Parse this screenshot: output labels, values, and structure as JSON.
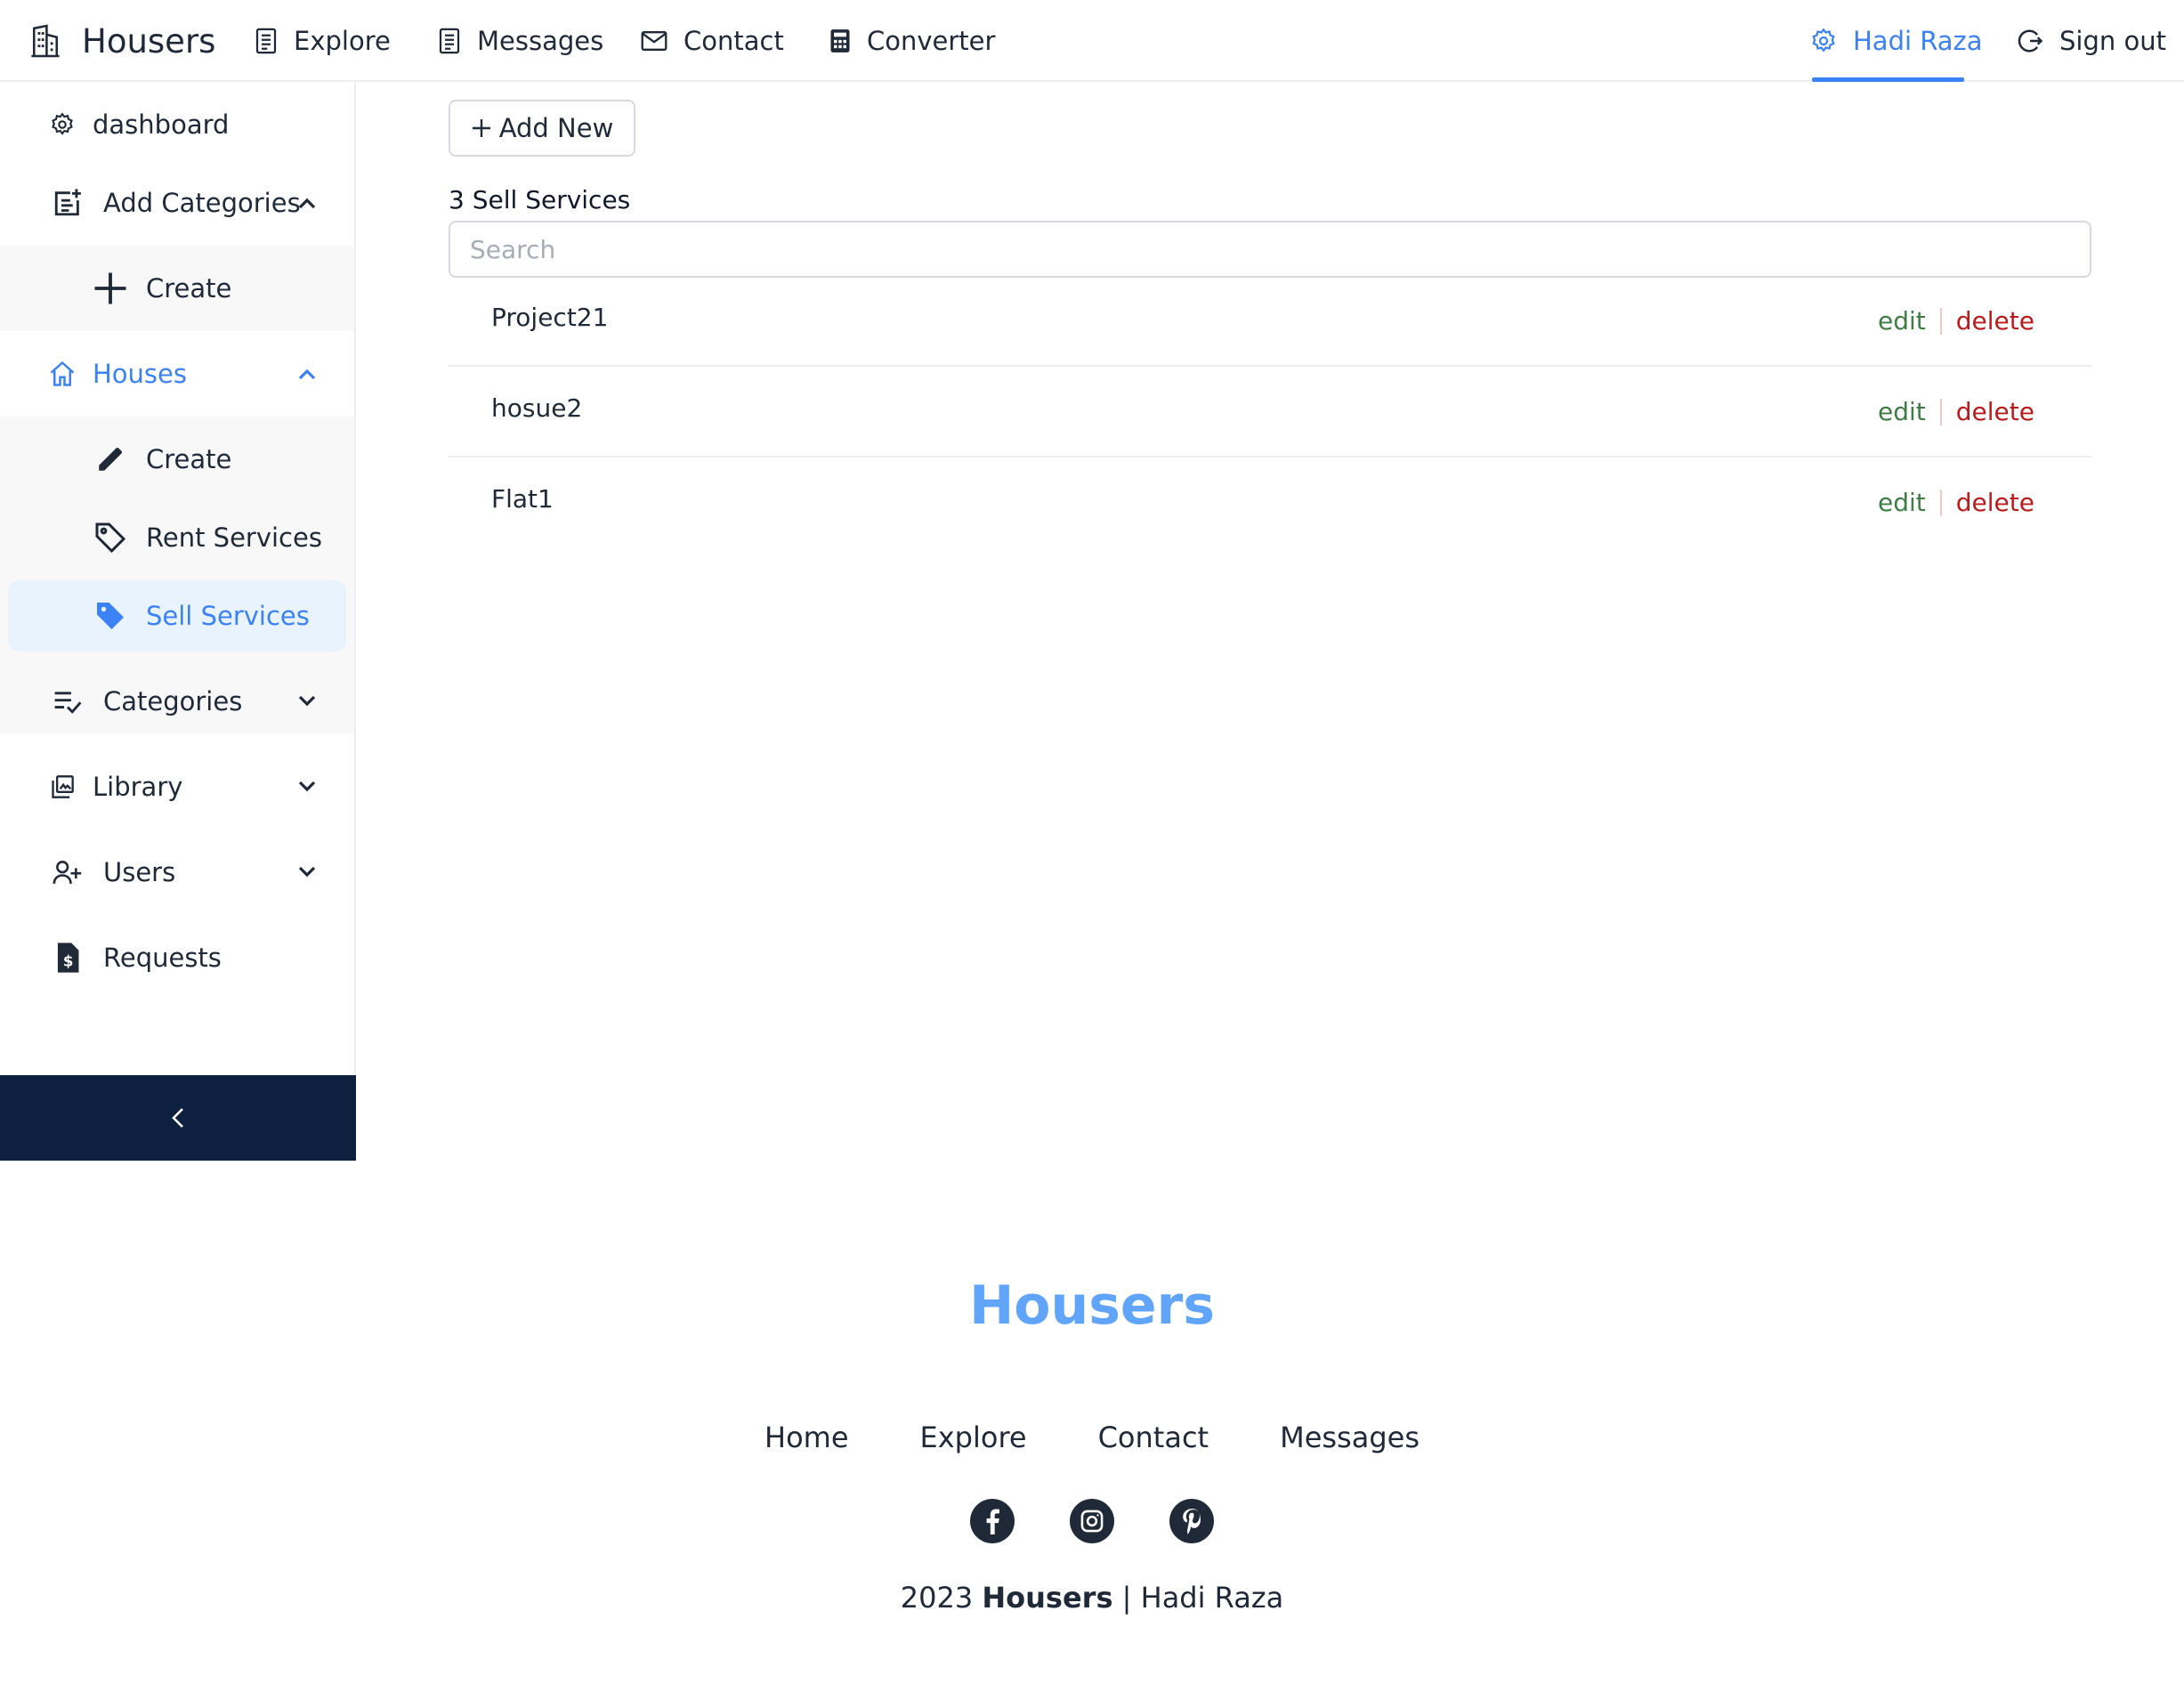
{
  "header": {
    "brand": "Housers",
    "nav": [
      {
        "label": "Explore",
        "icon": "list-doc-icon"
      },
      {
        "label": "Messages",
        "icon": "list-doc-icon"
      },
      {
        "label": "Contact",
        "icon": "mail-icon"
      },
      {
        "label": "Converter",
        "icon": "calculator-icon"
      }
    ],
    "user": {
      "label": "Hadi Raza",
      "icon": "gear-icon"
    },
    "signout": {
      "label": "Sign out",
      "icon": "logout-icon"
    }
  },
  "sidebar": {
    "items": [
      {
        "label": "dashboard",
        "icon": "gear-icon"
      },
      {
        "label": "Add Categories",
        "icon": "add-note-icon",
        "expanded": true
      },
      {
        "label": "Create",
        "icon": "plus-icon"
      },
      {
        "label": "Houses",
        "icon": "home-icon",
        "expanded": true
      },
      {
        "label": "Create",
        "icon": "pencil-icon"
      },
      {
        "label": "Rent Services",
        "icon": "tag-icon"
      },
      {
        "label": "Sell Services",
        "icon": "tag-filled-icon",
        "selected": true
      },
      {
        "label": "Categories",
        "icon": "list-check-icon",
        "expanded": false
      },
      {
        "label": "Library",
        "icon": "library-icon",
        "expanded": false
      },
      {
        "label": "Users",
        "icon": "user-add-icon",
        "expanded": false
      },
      {
        "label": "Requests",
        "icon": "invoice-icon"
      }
    ],
    "collapse_icon": "chevron-left-icon"
  },
  "main": {
    "add_button": "Add New",
    "count": "3",
    "title": "Sell Services",
    "search_placeholder": "Search",
    "rows": [
      {
        "name": "Project21",
        "edit": "edit",
        "delete": "delete"
      },
      {
        "name": "hosue2",
        "edit": "edit",
        "delete": "delete"
      },
      {
        "name": "Flat1",
        "edit": "edit",
        "delete": "delete"
      }
    ]
  },
  "footer": {
    "brand": "Housers",
    "links": [
      "Home",
      "Explore",
      "Contact",
      "Messages"
    ],
    "social": [
      "facebook-icon",
      "instagram-icon",
      "pinterest-icon"
    ],
    "copy_year": "2023",
    "copy_brand": "Housers",
    "copy_sep": "|",
    "copy_author": "Hadi Raza"
  },
  "colors": {
    "accent": "#3b82f6",
    "brand_footer": "#60a5fa",
    "edit": "#3f7d45",
    "delete": "#b91c1c",
    "sidebar_collapse": "#0e2040",
    "selected_bg": "#e9f3fe"
  }
}
